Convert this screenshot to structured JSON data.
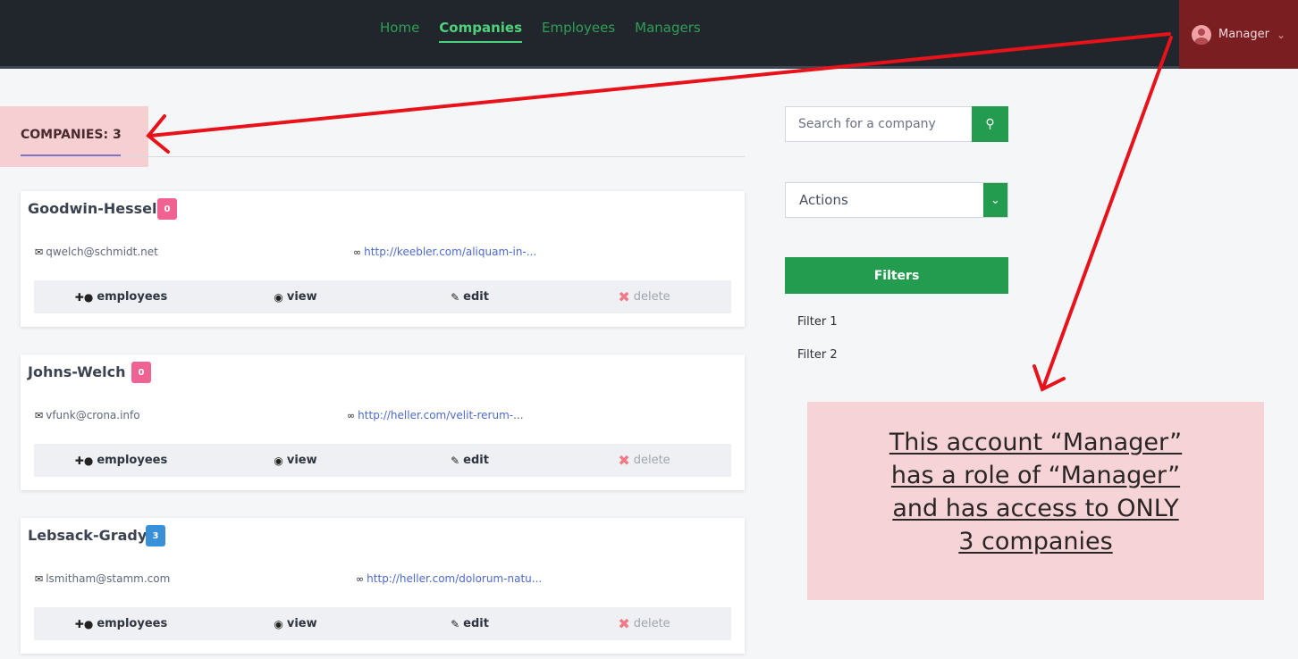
{
  "navbar": {
    "links": [
      {
        "label": "Home",
        "active": false
      },
      {
        "label": "Companies",
        "active": true
      },
      {
        "label": "Employees",
        "active": false
      },
      {
        "label": "Managers",
        "active": false
      }
    ],
    "user": {
      "name": "Manager",
      "avatar_icon": "user-avatar-icon",
      "chevron_icon": "chevron-down-icon"
    }
  },
  "header": {
    "title": "COMPANIES: 3"
  },
  "companies": [
    {
      "name": "Goodwin-Hessel",
      "count": "0",
      "badge_color": "#f06292",
      "email": "qwelch@schmidt.net",
      "url": "http://keebler.com/aliquam-in-..."
    },
    {
      "name": "Johns-Welch",
      "count": "0",
      "badge_color": "#f06292",
      "email": "vfunk@crona.info",
      "url": "http://heller.com/velit-rerum-..."
    },
    {
      "name": "Lebsack-Grady",
      "count": "3",
      "badge_color": "#3a8fd9",
      "email": "lsmitham@stamm.com",
      "url": "http://heller.com/dolorum-natu..."
    }
  ],
  "card_actions": {
    "employees": "employees",
    "view": "view",
    "edit": "edit",
    "delete": "delete"
  },
  "sidebar": {
    "search_placeholder": "Search for a company",
    "actions_label": "Actions",
    "filters_label": "Filters",
    "filters": [
      "Filter 1",
      "Filter 2"
    ]
  },
  "annotation": {
    "lines": [
      "This account “Manager”",
      "has a role of “Manager”",
      "and has access to ONLY",
      "3 companies"
    ]
  },
  "colors": {
    "accent": "#249c4f",
    "nav_active": "#4fd07b",
    "arrow": "#e8121a"
  }
}
